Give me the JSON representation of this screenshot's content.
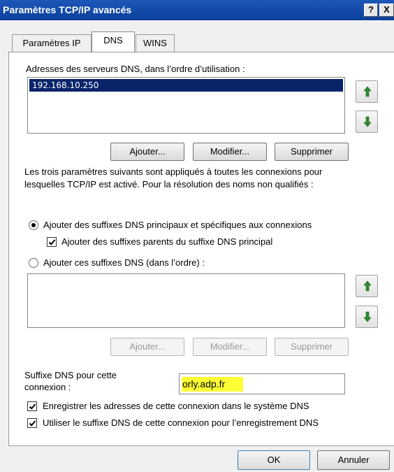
{
  "window": {
    "title": "Paramètres TCP/IP avancés",
    "help_label": "?",
    "close_label": "X"
  },
  "tabs": [
    {
      "label": "Paramètres IP"
    },
    {
      "label": "DNS"
    },
    {
      "label": "WINS"
    }
  ],
  "dns_servers": {
    "label": "Adresses des serveurs DNS, dans l’ordre d’utilisation :",
    "items": [
      "192.168.10.250"
    ],
    "buttons": {
      "add": "Ajouter...",
      "modify": "Modifier...",
      "remove": "Supprimer"
    }
  },
  "info_text": {
    "line1": "Les trois paramètres suivants sont appliqués à toutes les connexions pour",
    "line2": "lesquelles TCP/IP est activé. Pour la résolution des noms non qualifiés :"
  },
  "options": {
    "radio_primary": {
      "label": "Ajouter des suffixes DNS principaux et spécifiques aux connexions",
      "checked": true
    },
    "check_parent": {
      "label": "Ajouter des suffixes parents du suffixe DNS principal",
      "checked": true
    },
    "radio_list": {
      "label": "Ajouter ces suffixes DNS (dans l’ordre) :",
      "checked": false
    }
  },
  "suffix_list": {
    "items": [],
    "buttons": {
      "add": "Ajouter...",
      "modify": "Modifier...",
      "remove": "Supprimer"
    }
  },
  "connection_suffix": {
    "label_line1": "Suffixe DNS pour cette",
    "label_line2": "connexion :",
    "value": "orly.adp.fr"
  },
  "register": {
    "register_label": "Enregistrer les adresses de cette connexion dans le système DNS",
    "register_checked": true,
    "use_suffix_label": "Utiliser le suffixe DNS de cette connexion pour l’enregistrement DNS",
    "use_suffix_checked": true
  },
  "footer": {
    "ok_label": "OK",
    "cancel_label": "Annuler"
  },
  "colors": {
    "titlebar": "#0a3f9c",
    "selection": "#0a246a",
    "highlight": "#ffff33",
    "arrow": "#2e8b2e"
  }
}
